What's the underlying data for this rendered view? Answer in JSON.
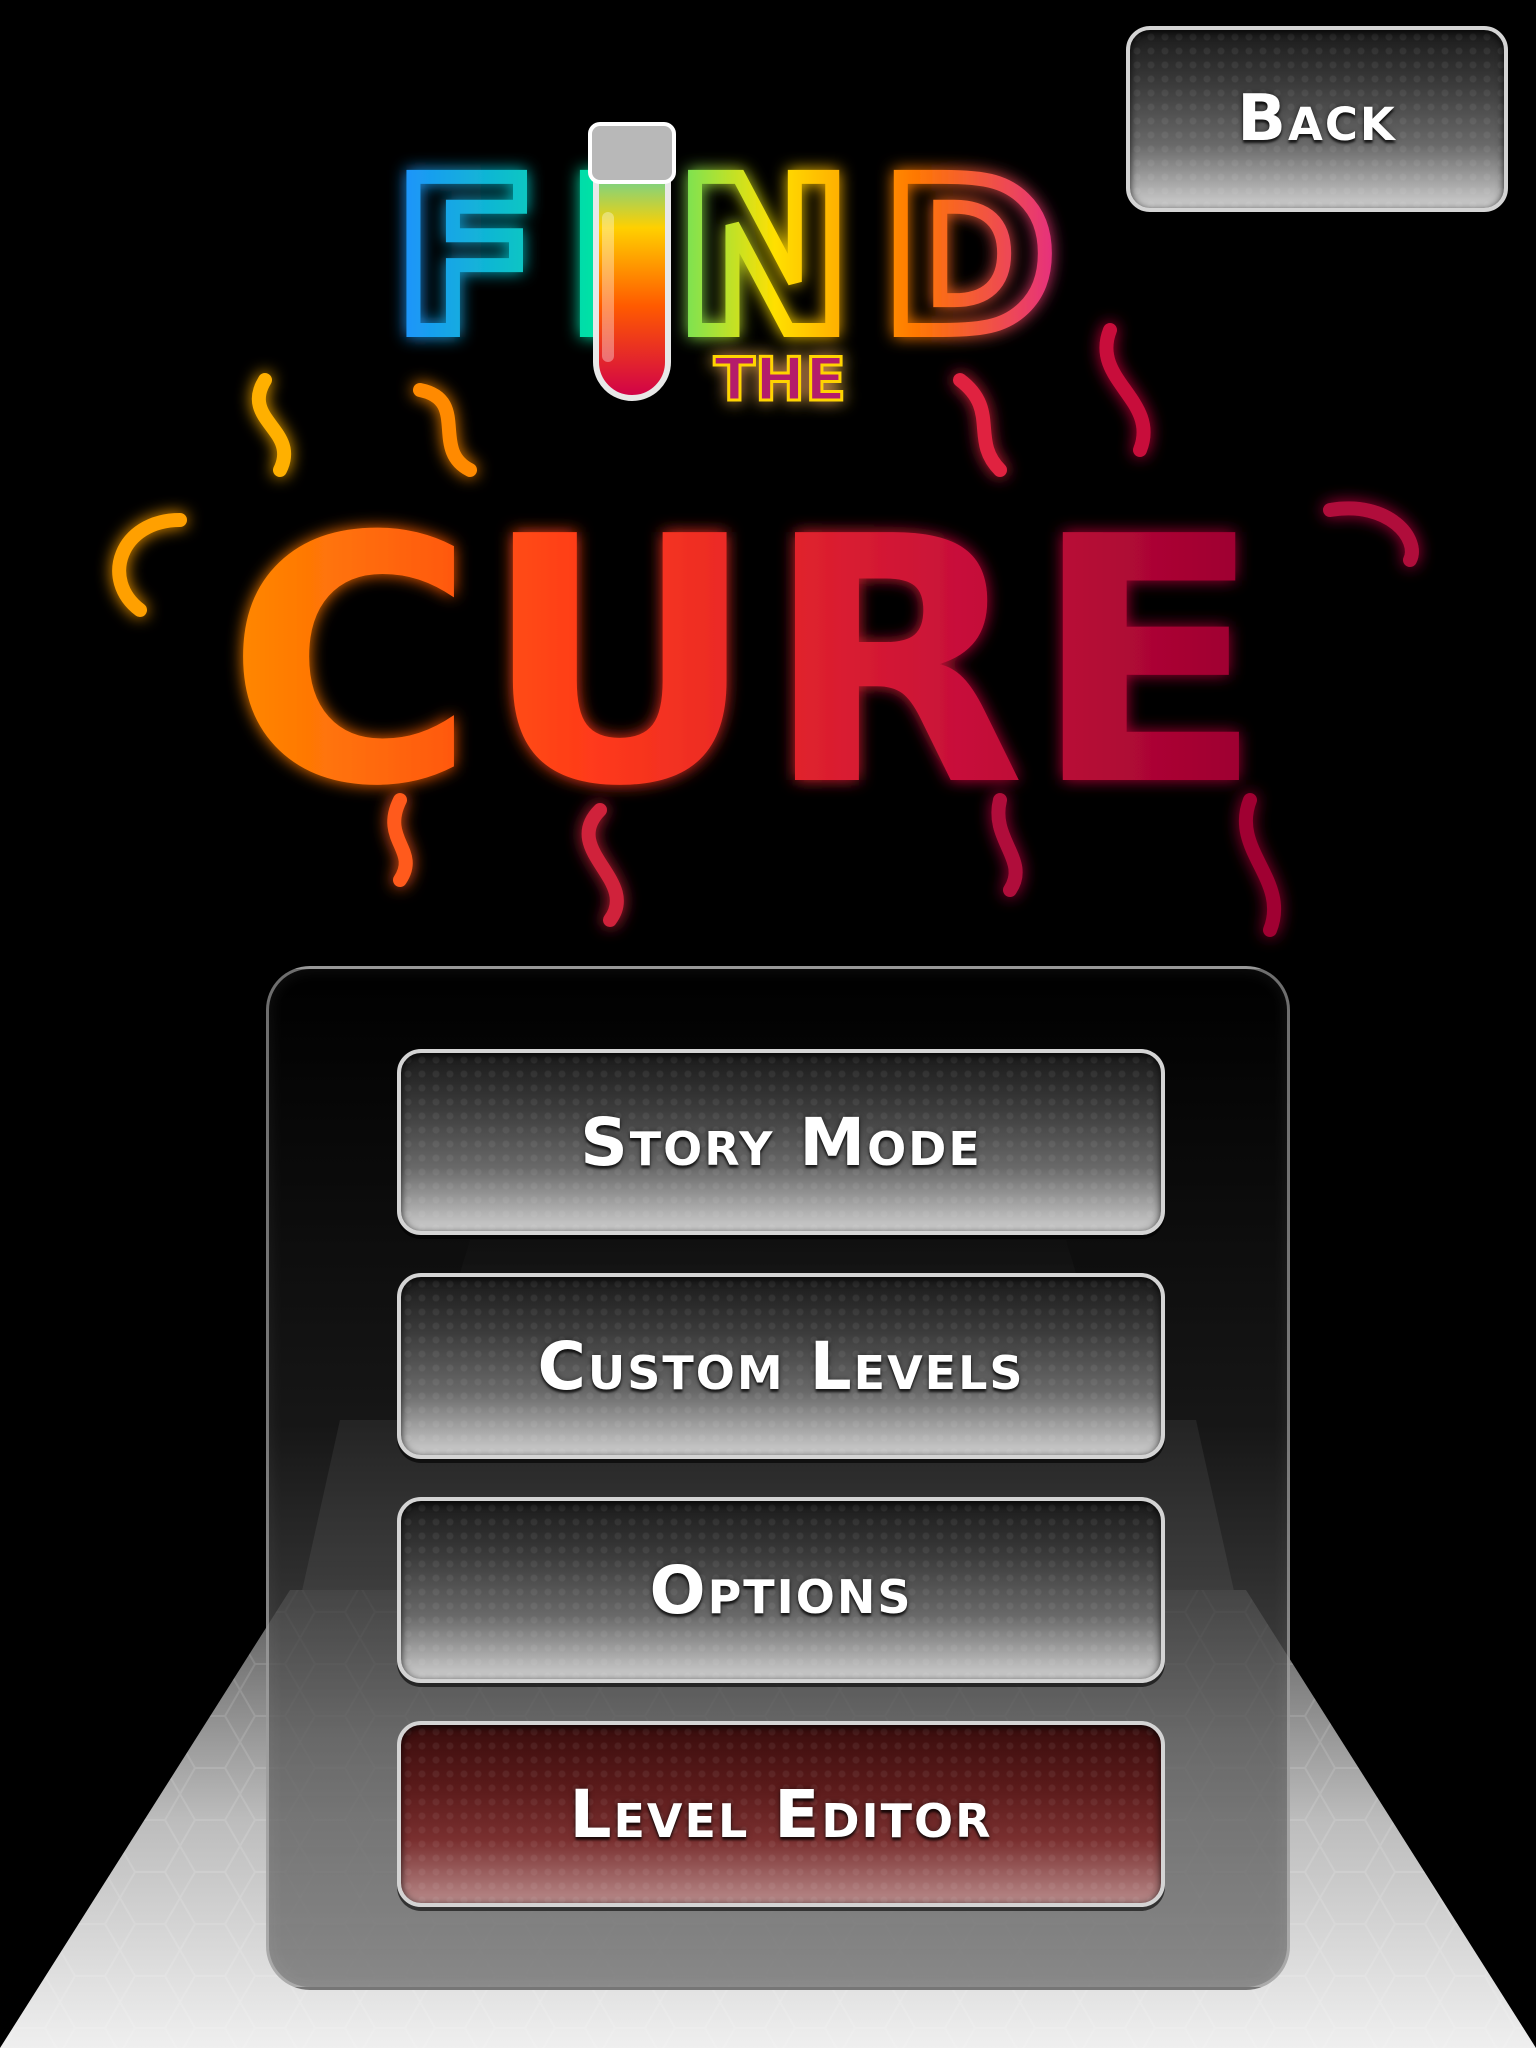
{
  "game": {
    "logo": {
      "line1": "FIND",
      "line2": "THE",
      "line3": "CURE"
    }
  },
  "buttons": {
    "back": "Back",
    "story_mode": "Story Mode",
    "custom_levels": "Custom Levels",
    "options": "Options",
    "level_editor": "Level Editor"
  },
  "colors": {
    "background": "#000000",
    "button_border": "#d4d4d4",
    "level_editor_tint": "#7a3030",
    "logo_gradient_find": [
      "#1e90ff",
      "#00e5a0",
      "#ffe000",
      "#ff7a00",
      "#e0209a"
    ],
    "logo_gradient_cure": [
      "#ff8a00",
      "#ff3a1a",
      "#c8103a",
      "#9a0030"
    ]
  },
  "icons": {
    "test_tube": "test-tube-icon"
  }
}
